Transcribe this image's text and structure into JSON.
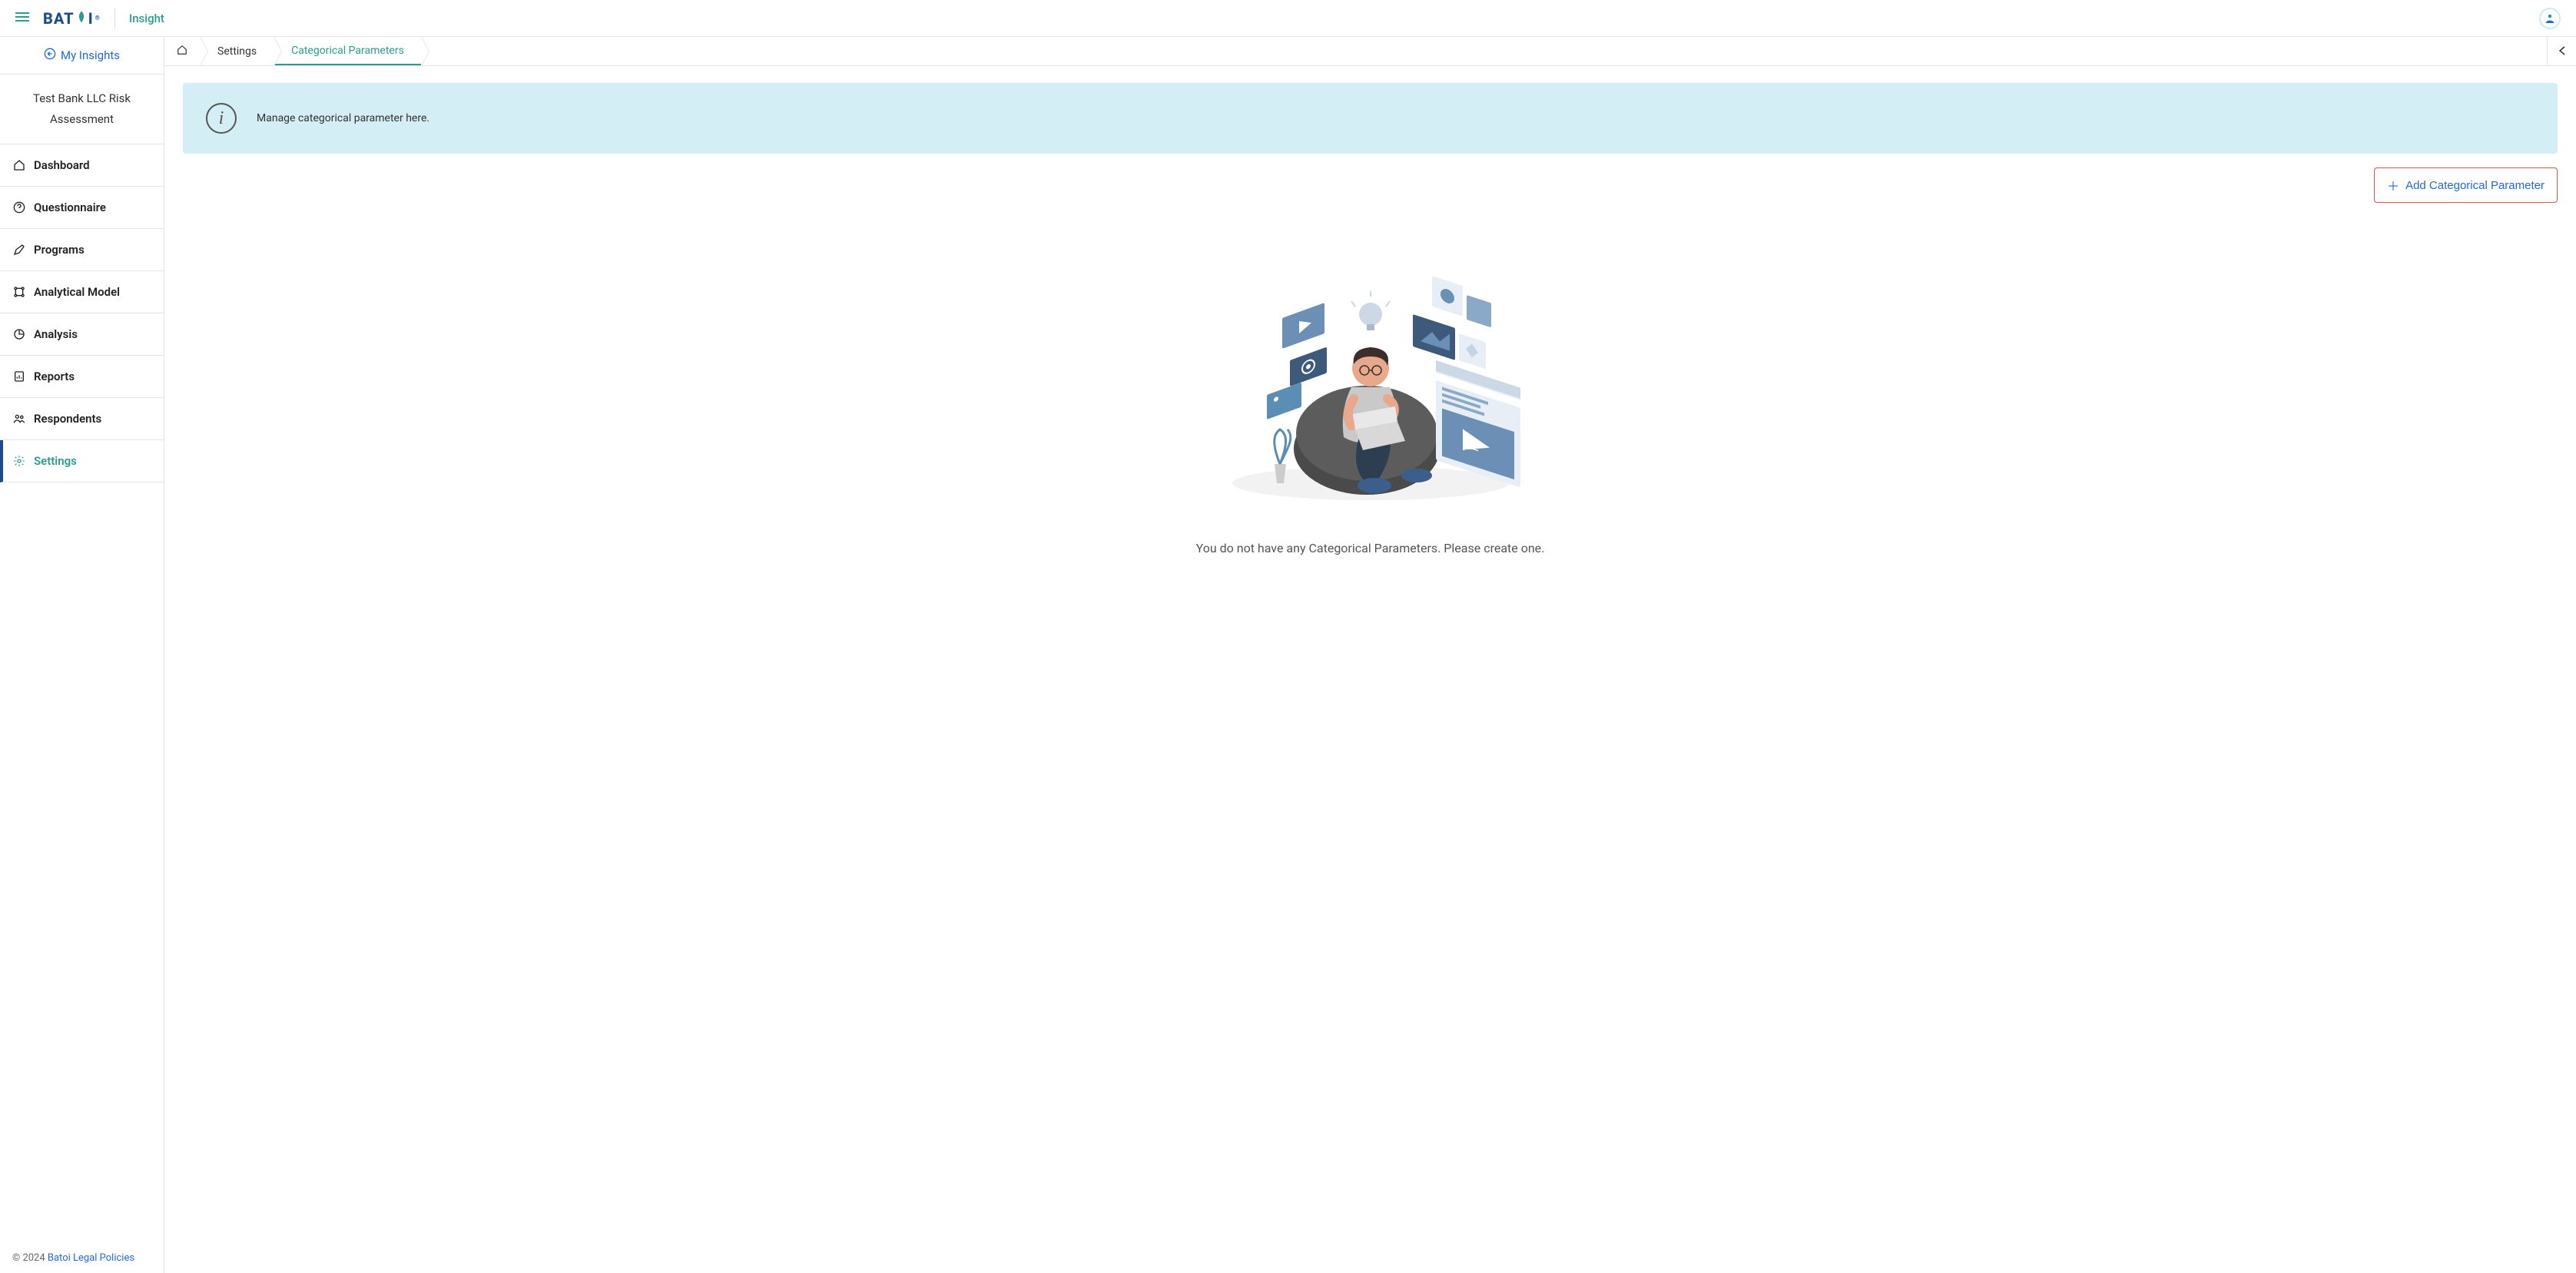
{
  "header": {
    "logo_text": "BAT",
    "logo_text_end": "I",
    "app_name": "Insight"
  },
  "sidebar": {
    "my_insights_label": "My Insights",
    "project_name": "Test Bank LLC Risk Assessment",
    "items": [
      {
        "label": "Dashboard",
        "icon": "home"
      },
      {
        "label": "Questionnaire",
        "icon": "help-circle"
      },
      {
        "label": "Programs",
        "icon": "pen"
      },
      {
        "label": "Analytical Model",
        "icon": "nodes"
      },
      {
        "label": "Analysis",
        "icon": "pie"
      },
      {
        "label": "Reports",
        "icon": "bar-doc"
      },
      {
        "label": "Respondents",
        "icon": "users"
      },
      {
        "label": "Settings",
        "icon": "gear",
        "active": true
      }
    ],
    "footer_copyright": "© 2024 ",
    "footer_link1": "Batoi",
    "footer_sep": " ",
    "footer_link2": "Legal Policies"
  },
  "breadcrumb": {
    "settings": "Settings",
    "categorical_parameters": "Categorical Parameters"
  },
  "banner": {
    "message": "Manage categorical parameter here."
  },
  "actions": {
    "add_label": "Add Categorical Parameter"
  },
  "empty_state": {
    "message": "You do not have any Categorical Parameters. Please create one."
  }
}
